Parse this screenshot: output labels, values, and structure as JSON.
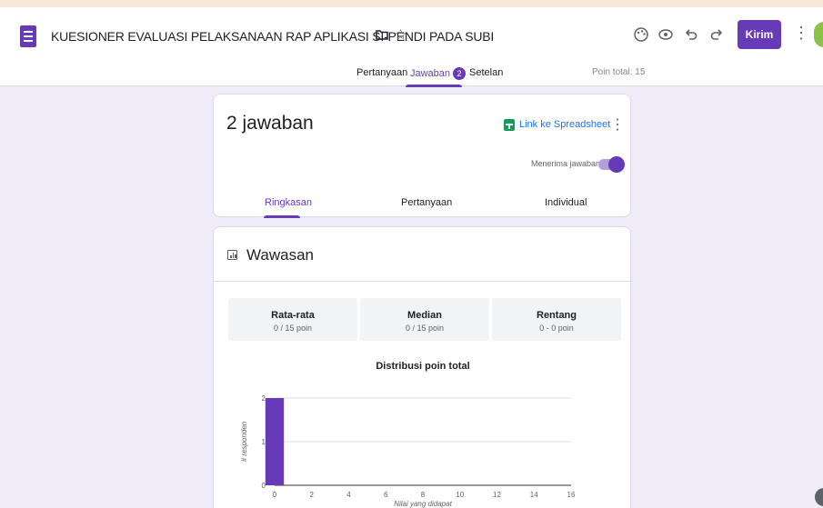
{
  "header": {
    "doc_title": "KUESIONER EVALUASI PELAKSANAAN RAP APLIKASI SI-PENDI PADA SUBI",
    "send_label": "Kirim",
    "icons": [
      "forms-icon",
      "folder-icon",
      "star-icon",
      "palette-icon",
      "preview-icon",
      "undo-icon",
      "redo-icon",
      "more-vert-icon"
    ]
  },
  "tabs": [
    {
      "label": "Pertanyaan"
    },
    {
      "label": "Jawaban",
      "badge": "2"
    },
    {
      "label": "Setelan"
    }
  ],
  "points_total": "Poin total: 15",
  "responses": {
    "count_label": "2 jawaban",
    "sheet_link": "Link ke Spreadsheet",
    "accepting_label": "Menerima jawaban",
    "accepting": true,
    "sub_tabs": [
      {
        "label": "Ringkasan"
      },
      {
        "label": "Pertanyaan"
      },
      {
        "label": "Individual"
      }
    ]
  },
  "insights": {
    "title": "Wawasan",
    "stats": [
      {
        "label": "Rata-rata",
        "value": "0 / 15 poin"
      },
      {
        "label": "Median",
        "value": "0 / 15 poin"
      },
      {
        "label": "Rentang",
        "value": "0 - 0 poin"
      }
    ]
  },
  "chart_data": {
    "type": "bar",
    "title": "Distribusi poin total",
    "xlabel": "Nilai yang didapat",
    "ylabel": "# responden",
    "x": [
      0
    ],
    "values": [
      2
    ],
    "xlim": [
      0,
      16
    ],
    "ylim": [
      0,
      2
    ],
    "xticks": [
      0,
      2,
      4,
      6,
      8,
      10,
      12,
      14,
      16
    ],
    "yticks": [
      0,
      1,
      2
    ],
    "grid": true,
    "color": "#673ab7"
  },
  "colors": {
    "accent": "#673ab7",
    "background": "#f0ebf8",
    "link": "#1a73e8",
    "sheets": "#0f9d58"
  }
}
